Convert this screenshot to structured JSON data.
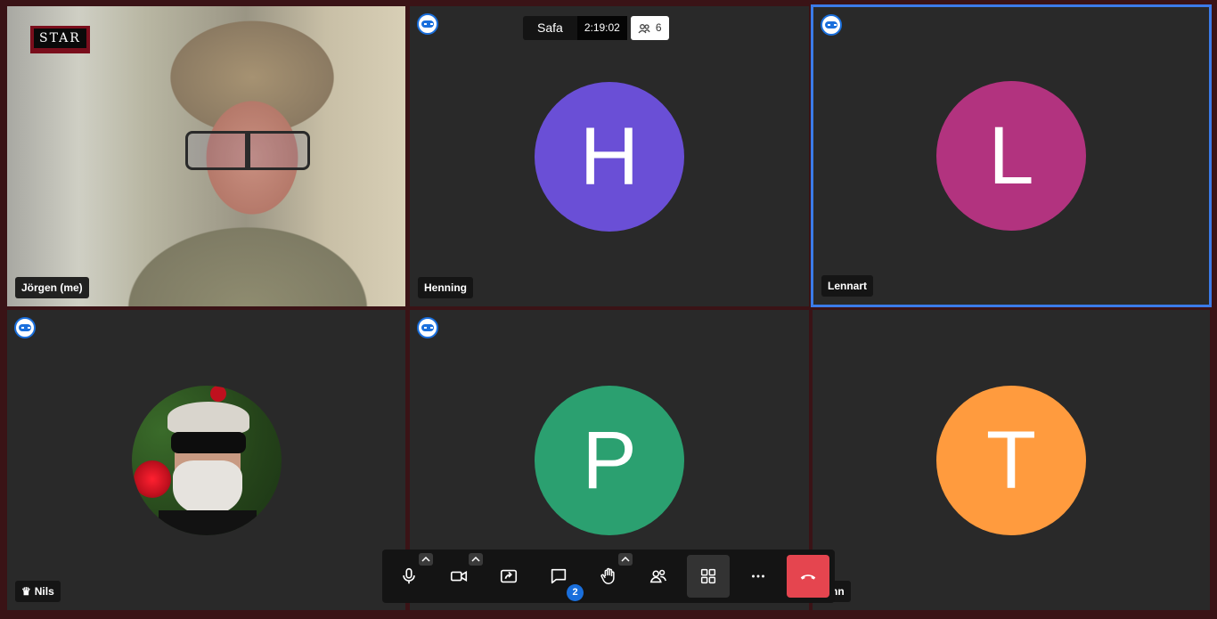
{
  "meeting": {
    "name": "Safa",
    "timer": "2:19:02",
    "participant_count": "6"
  },
  "participants": [
    {
      "name": "Jörgen (me)",
      "type": "video"
    },
    {
      "name": "Henning",
      "initial": "H",
      "color": "#6a4fd6"
    },
    {
      "name": "Lennart",
      "initial": "L",
      "color": "#b2337f"
    },
    {
      "name": "Nils",
      "type": "photo"
    },
    {
      "name": "",
      "initial": "P",
      "color": "#2ba070"
    },
    {
      "name": "nn",
      "initial": "T",
      "color": "#ff9b3e"
    }
  ],
  "logo_text": "STAR",
  "toolbar": {
    "chat_unread": "2",
    "buttons": [
      "microphone-icon",
      "camera-icon",
      "share-screen-icon",
      "chat-icon",
      "raise-hand-icon",
      "participants-icon",
      "tile-view-icon",
      "more-icon",
      "hangup-icon"
    ]
  },
  "colors": {
    "background": "#3a1316",
    "tile": "#292929",
    "active_border": "#3b7be8",
    "hangup": "#e5454f",
    "badge": "#1a6fdc"
  }
}
